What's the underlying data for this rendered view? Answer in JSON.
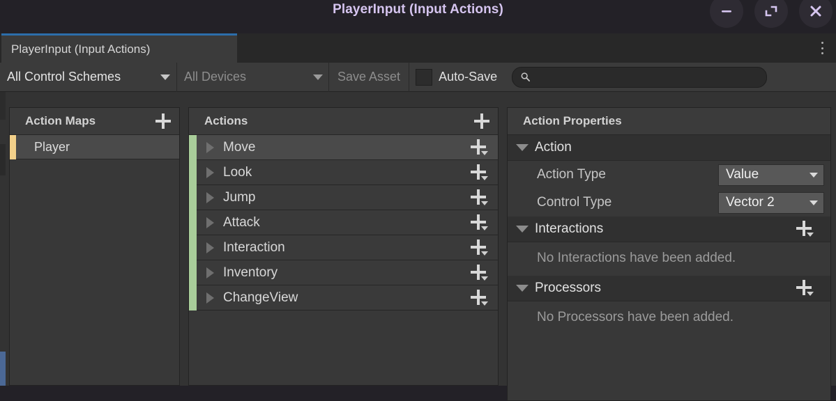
{
  "window": {
    "title": "PlayerInput (Input Actions)",
    "controls": [
      {
        "name": "minimize",
        "glyph": "minimize-icon"
      },
      {
        "name": "maximize",
        "glyph": "maximize-icon"
      },
      {
        "name": "close",
        "glyph": "close-icon"
      }
    ],
    "accent_title_color": "#d6c5f0",
    "background_color": "#232127"
  },
  "tabs": [
    {
      "label": "PlayerInput (Input Actions)",
      "active": true,
      "accent_color": "#2c6eab"
    }
  ],
  "tab_overflow_menu": "kebab-menu-icon",
  "toolbar": {
    "control_schemes_dropdown": "All Control Schemes",
    "devices_dropdown": "All Devices",
    "save_asset_label": "Save Asset",
    "save_asset_enabled": false,
    "auto_save_label": "Auto-Save",
    "auto_save_checked": false,
    "search": {
      "value": "",
      "placeholder": "",
      "icon": "search-icon"
    }
  },
  "action_maps_panel": {
    "header": "Action Maps",
    "add_label": "+",
    "items": [
      {
        "name": "Player",
        "selected": true,
        "color": "#f2d08a"
      }
    ]
  },
  "actions_panel": {
    "header": "Actions",
    "add_label": "+",
    "items": [
      {
        "name": "Move",
        "selected": true,
        "expanded": false,
        "color": "#a9cd9a"
      },
      {
        "name": "Look",
        "selected": false,
        "expanded": false,
        "color": "#a9cd9a"
      },
      {
        "name": "Jump",
        "selected": false,
        "expanded": false,
        "color": "#a9cd9a"
      },
      {
        "name": "Attack",
        "selected": false,
        "expanded": false,
        "color": "#a9cd9a"
      },
      {
        "name": "Interaction",
        "selected": false,
        "expanded": false,
        "color": "#a9cd9a"
      },
      {
        "name": "Inventory",
        "selected": false,
        "expanded": false,
        "color": "#a9cd9a"
      },
      {
        "name": "ChangeView",
        "selected": false,
        "expanded": false,
        "color": "#a9cd9a"
      }
    ]
  },
  "properties_panel": {
    "header": "Action Properties",
    "action_section": {
      "title": "Action",
      "expanded": true,
      "fields": [
        {
          "label": "Action Type",
          "value": "Value"
        },
        {
          "label": "Control Type",
          "value": "Vector 2"
        }
      ]
    },
    "interactions_section": {
      "title": "Interactions",
      "expanded": true,
      "add_label": "+",
      "empty_text": "No Interactions have been added."
    },
    "processors_section": {
      "title": "Processors",
      "expanded": true,
      "add_label": "+",
      "empty_text": "No Processors have been added."
    }
  }
}
